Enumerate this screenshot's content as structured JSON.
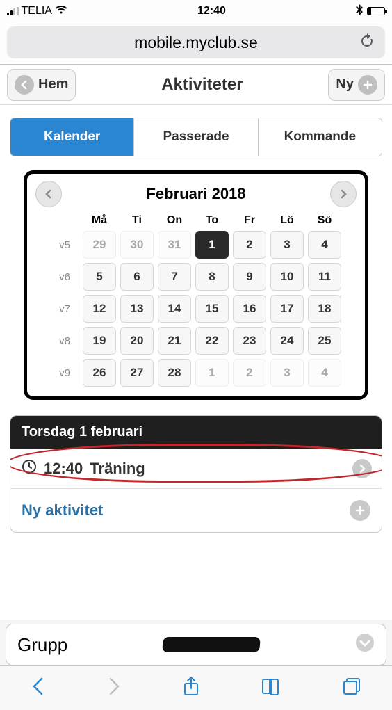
{
  "statusbar": {
    "carrier": "TELIA",
    "signal_active": 2,
    "signal_total": 4,
    "time": "12:40",
    "battery_pct": 18
  },
  "urlbar": {
    "url": "mobile.myclub.se"
  },
  "topbar": {
    "back_label": "Hem",
    "title": "Aktiviteter",
    "new_label": "Ny"
  },
  "tabs": {
    "items": [
      {
        "label": "Kalender",
        "active": true
      },
      {
        "label": "Passerade",
        "active": false
      },
      {
        "label": "Kommande",
        "active": false
      }
    ]
  },
  "calendar": {
    "title": "Februari 2018",
    "day_headers": [
      "Må",
      "Ti",
      "On",
      "To",
      "Fr",
      "Lö",
      "Sö"
    ],
    "weeks": [
      {
        "wk": "v5",
        "days": [
          {
            "n": "29",
            "other": true
          },
          {
            "n": "30",
            "other": true
          },
          {
            "n": "31",
            "other": true
          },
          {
            "n": "1",
            "selected": true
          },
          {
            "n": "2"
          },
          {
            "n": "3"
          },
          {
            "n": "4"
          }
        ]
      },
      {
        "wk": "v6",
        "days": [
          {
            "n": "5"
          },
          {
            "n": "6"
          },
          {
            "n": "7"
          },
          {
            "n": "8"
          },
          {
            "n": "9"
          },
          {
            "n": "10"
          },
          {
            "n": "11"
          }
        ]
      },
      {
        "wk": "v7",
        "days": [
          {
            "n": "12"
          },
          {
            "n": "13"
          },
          {
            "n": "14"
          },
          {
            "n": "15"
          },
          {
            "n": "16"
          },
          {
            "n": "17"
          },
          {
            "n": "18"
          }
        ]
      },
      {
        "wk": "v8",
        "days": [
          {
            "n": "19"
          },
          {
            "n": "20"
          },
          {
            "n": "21"
          },
          {
            "n": "22"
          },
          {
            "n": "23"
          },
          {
            "n": "24"
          },
          {
            "n": "25"
          }
        ]
      },
      {
        "wk": "v9",
        "days": [
          {
            "n": "26"
          },
          {
            "n": "27"
          },
          {
            "n": "28"
          },
          {
            "n": "1",
            "other": true
          },
          {
            "n": "2",
            "other": true
          },
          {
            "n": "3",
            "other": true
          },
          {
            "n": "4",
            "other": true
          }
        ]
      }
    ]
  },
  "day_panel": {
    "date_label": "Torsdag 1 februari",
    "events": [
      {
        "time": "12:40",
        "title": "Träning"
      }
    ],
    "new_activity_label": "Ny aktivitet"
  },
  "group_bar": {
    "label": "Grupp"
  }
}
